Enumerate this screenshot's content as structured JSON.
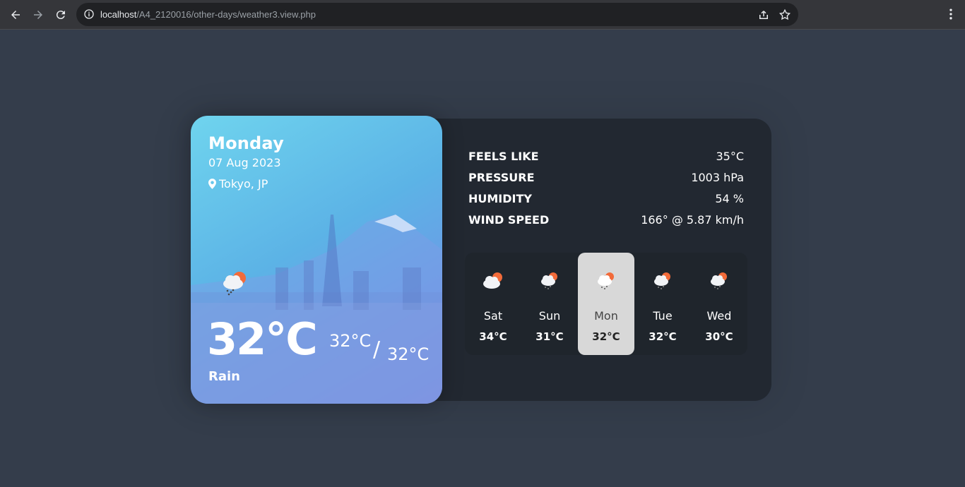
{
  "browser": {
    "url_host": "localhost",
    "url_path": "/A4_2120016/other-days/weather3.view.php"
  },
  "today": {
    "day": "Monday",
    "date": "07 Aug 2023",
    "location": "Tokyo, JP",
    "temperature": "32°C",
    "high": "32°C",
    "separator": "/",
    "low": "32°C",
    "condition": "Rain",
    "icon": "rain-cloud-sun-icon"
  },
  "stats": [
    {
      "label": "FEELS LIKE",
      "value": "35°C"
    },
    {
      "label": "PRESSURE",
      "value": "1003 hPa"
    },
    {
      "label": "HUMIDITY",
      "value": "54 %"
    },
    {
      "label": "WIND SPEED",
      "value": "166° @ 5.87 km/h"
    }
  ],
  "week": [
    {
      "day": "Sat",
      "temp": "34°C",
      "icon": "cloud-sun-icon",
      "active": false
    },
    {
      "day": "Sun",
      "temp": "31°C",
      "icon": "rain-cloud-sun-icon",
      "active": false
    },
    {
      "day": "Mon",
      "temp": "32°C",
      "icon": "rain-cloud-sun-icon",
      "active": true
    },
    {
      "day": "Tue",
      "temp": "32°C",
      "icon": "rain-cloud-sun-icon",
      "active": false
    },
    {
      "day": "Wed",
      "temp": "30°C",
      "icon": "rain-cloud-sun-icon",
      "active": false
    }
  ],
  "colors": {
    "background": "#343d4b",
    "card": "#222831",
    "active_day": "#d8d8d8",
    "sun": "#f26b3a"
  }
}
